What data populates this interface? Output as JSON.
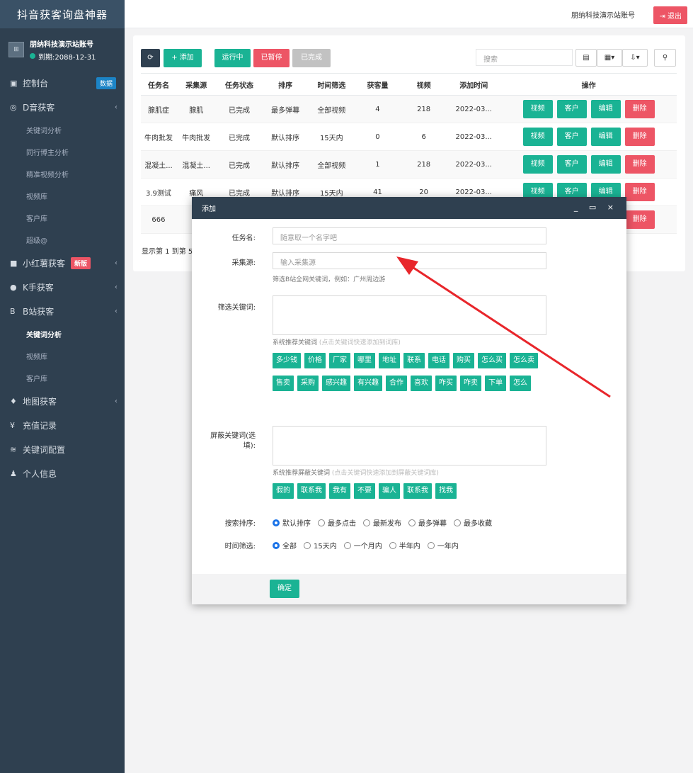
{
  "sidebar": {
    "brand": "抖音获客询盘神器",
    "profile": {
      "name": "朋纳科技演示站账号",
      "expiry": "到期:2088-12-31"
    },
    "items": [
      {
        "icon": "▣",
        "label": "控制台",
        "badge": "数据"
      },
      {
        "icon": "◎",
        "label": "D音获客",
        "chev": "‹"
      },
      {
        "sub": "关键词分析"
      },
      {
        "sub": "同行博主分析"
      },
      {
        "sub": "精准视频分析"
      },
      {
        "sub": "视频库"
      },
      {
        "sub": "客户库"
      },
      {
        "sub": "超级@"
      },
      {
        "icon": "■",
        "label": "小红薯获客",
        "badge": "新版",
        "chev": "‹"
      },
      {
        "icon": "●",
        "label": "K手获客",
        "chev": "‹"
      },
      {
        "icon": "B",
        "label": "B站获客",
        "chev": "‹"
      },
      {
        "sub": "关键词分析",
        "active": true
      },
      {
        "sub": "视频库"
      },
      {
        "sub": "客户库"
      },
      {
        "icon": "♦",
        "label": "地图获客",
        "chev": "‹"
      },
      {
        "icon": "¥",
        "label": "充值记录"
      },
      {
        "icon": "≋",
        "label": "关键词配置"
      },
      {
        "icon": "♟",
        "label": "个人信息"
      }
    ]
  },
  "topbar": {
    "account": "朋纳科技演示站账号",
    "logout": "退出"
  },
  "toolbar": {
    "refresh_icon": "refresh-icon",
    "add": "+ 添加",
    "running": "运行中",
    "paused": "已暂停",
    "done": "已完成",
    "search_placeholder": "搜索"
  },
  "table": {
    "headers": [
      "任务名",
      "采集源",
      "任务状态",
      "排序",
      "时间筛选",
      "获客量",
      "视频",
      "添加时间",
      "操作"
    ],
    "rows": [
      [
        "腺肌症",
        "腺肌",
        "已完成",
        "最多弹幕",
        "全部视频",
        "4",
        "218",
        "2022-03..."
      ],
      [
        "牛肉批发",
        "牛肉批发",
        "已完成",
        "默认排序",
        "15天内",
        "0",
        "6",
        "2022-03..."
      ],
      [
        "混凝土...",
        "混凝土...",
        "已完成",
        "默认排序",
        "全部视频",
        "1",
        "218",
        "2022-03..."
      ],
      [
        "3.9测试",
        "痛风",
        "已完成",
        "默认排序",
        "15天内",
        "41",
        "20",
        "2022-03..."
      ],
      [
        "666",
        "",
        "",
        "",
        "",
        "",
        "",
        ""
      ]
    ],
    "ops": {
      "video": "视频",
      "customer": "客户",
      "edit": "编辑",
      "delete": "删除"
    },
    "page_info": "显示第 1 到第 5"
  },
  "modal": {
    "title": "添加",
    "controls": "_ ▭ ×",
    "task_label": "任务名:",
    "task_placeholder": "随意取一个名字吧",
    "source_label": "采集源:",
    "source_placeholder": "输入采集源",
    "source_hint": "筛选B站全网关键词，例如：广州周边游",
    "filter_label": "筛选关键词:",
    "filter_hint": "系统推荐关键词",
    "filter_hint_light": "(点击关键词快速添加到词库)",
    "filter_tags": [
      "多少钱",
      "价格",
      "厂家",
      "哪里",
      "地址",
      "联系",
      "电话",
      "购买",
      "怎么买",
      "怎么卖",
      "售卖",
      "采购",
      "感兴趣",
      "有兴趣",
      "合作",
      "喜欢",
      "咋买",
      "咋卖",
      "下单",
      "怎么"
    ],
    "block_label": "屏蔽关键词(选填):",
    "block_label_1": "屏蔽关键词(选",
    "block_label_2": "填):",
    "block_hint": "系统推荐屏蔽关键词",
    "block_hint_light": "(点击关键词快速添加到屏蔽关键词库)",
    "block_tags": [
      "假的",
      "联系我",
      "我有",
      "不要",
      "骗人",
      "联系我",
      "找我"
    ],
    "sort_label": "搜索排序:",
    "sort_options": [
      "默认排序",
      "最多点击",
      "最新发布",
      "最多弹幕",
      "最多收藏"
    ],
    "time_label": "时间筛选:",
    "time_options": [
      "全部",
      "15天内",
      "一个月内",
      "半年内",
      "一年内"
    ],
    "confirm": "确定"
  },
  "colors": {
    "sidebar": "#2f4050",
    "primary": "#1ab394",
    "danger": "#ed5565",
    "dark_btn": "#2f4050",
    "arrow": "#e8262b"
  }
}
